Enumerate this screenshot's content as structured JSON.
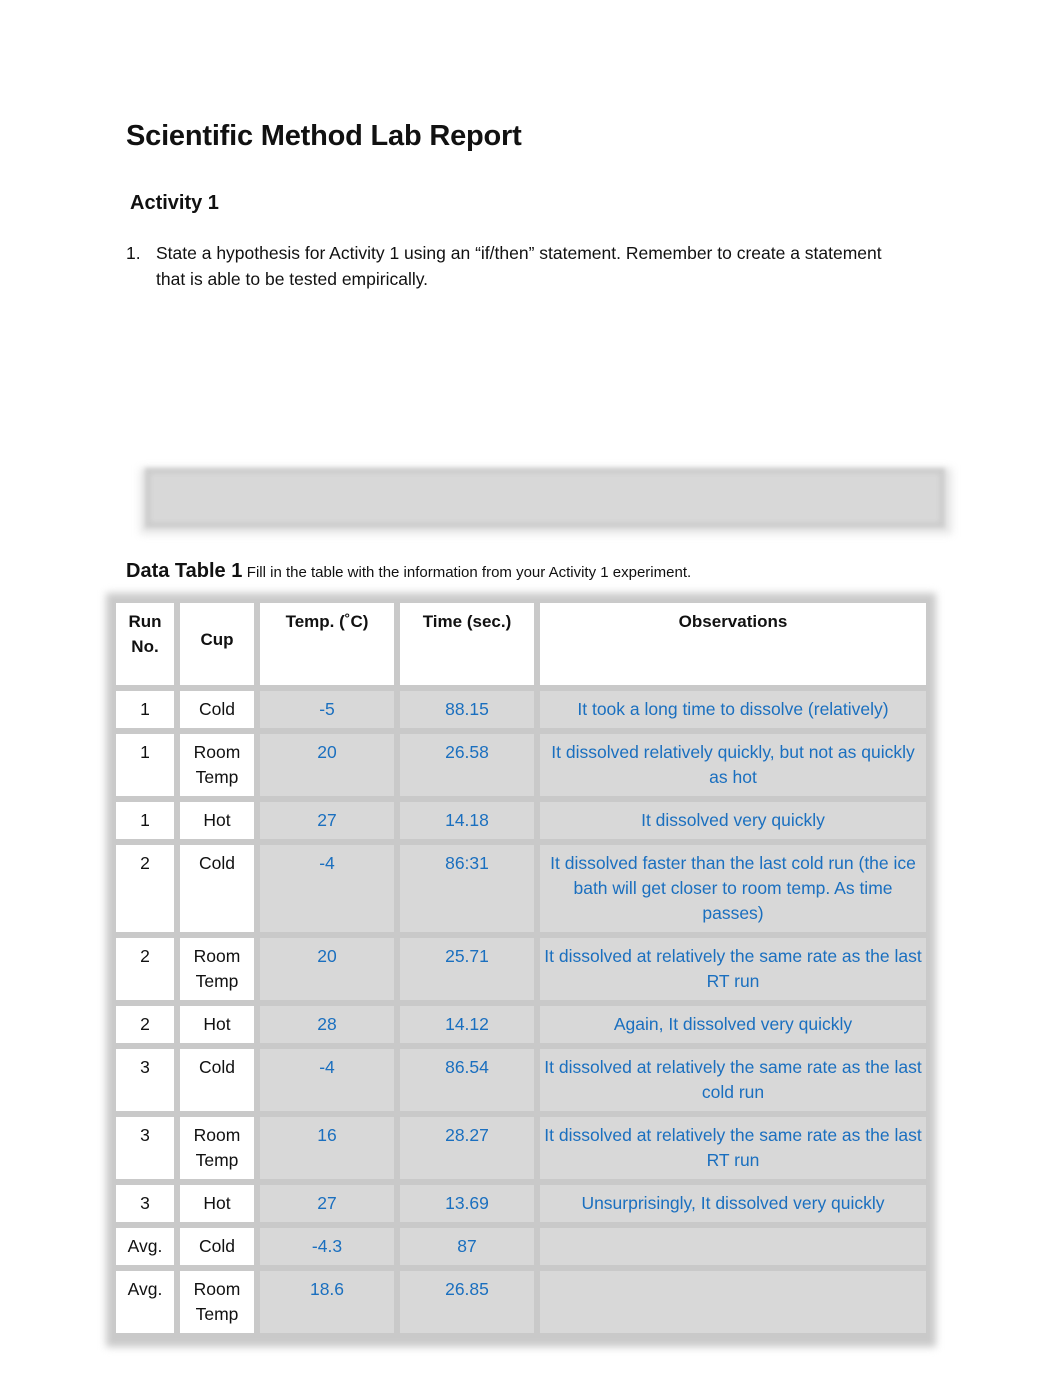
{
  "document": {
    "title": "Scientific Method Lab Report",
    "section": "Activity 1",
    "question": {
      "number": "1.",
      "text": "State a hypothesis for Activity 1 using an “if/then” statement. Remember to create a statement that is able to be tested empirically."
    },
    "data_table": {
      "caption_bold": "Data Table 1",
      "caption_text": "Fill in the table with the information from your Activity 1 experiment.",
      "headers": [
        "Run No.",
        "Cup",
        "Temp. (˚C)",
        "Time (sec.)",
        "Observations"
      ],
      "rows": [
        {
          "run": "1",
          "cup": "Cold",
          "temp": "-5",
          "time": "88.15",
          "obs": "It took a long time to dissolve (relatively)"
        },
        {
          "run": "1",
          "cup": "Room Temp",
          "temp": "20",
          "time": "26.58",
          "obs": "It dissolved relatively quickly, but not as quickly as hot"
        },
        {
          "run": "1",
          "cup": "Hot",
          "temp": "27",
          "time": "14.18",
          "obs": "It dissolved very quickly"
        },
        {
          "run": "2",
          "cup": "Cold",
          "temp": "-4",
          "time": "86:31",
          "obs": "It dissolved faster than the last cold run (the ice bath will get closer to room temp. As time passes)"
        },
        {
          "run": "2",
          "cup": "Room Temp",
          "temp": "20",
          "time": "25.71",
          "obs": "It dissolved at relatively the same rate as the last RT run"
        },
        {
          "run": "2",
          "cup": "Hot",
          "temp": "28",
          "time": "14.12",
          "obs": "Again, It dissolved very quickly"
        },
        {
          "run": "3",
          "cup": "Cold",
          "temp": "-4",
          "time": "86.54",
          "obs": "It dissolved at relatively the same rate as the last cold run"
        },
        {
          "run": "3",
          "cup": "Room Temp",
          "temp": "16",
          "time": "28.27",
          "obs": "It dissolved at relatively the same rate as the last RT run"
        },
        {
          "run": "3",
          "cup": "Hot",
          "temp": "27",
          "time": "13.69",
          "obs": "Unsurprisingly, It dissolved very quickly"
        },
        {
          "run": "Avg.",
          "cup": "Cold",
          "temp": "-4.3",
          "time": "87",
          "obs": ""
        },
        {
          "run": "Avg.",
          "cup": "Room Temp",
          "temp": "18.6",
          "time": "26.85",
          "obs": ""
        }
      ]
    }
  },
  "colors": {
    "answer_text": "#1a6fbf",
    "cell_gray": "#d8d8d8"
  }
}
